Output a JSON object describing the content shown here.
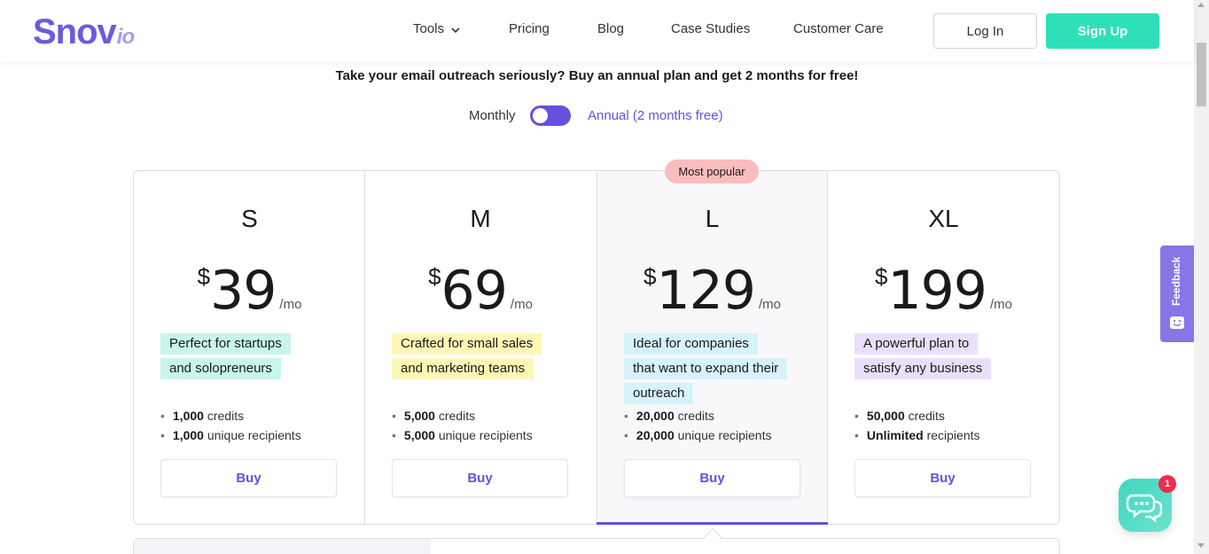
{
  "header": {
    "logo_main": "Snov",
    "logo_suffix": "io",
    "nav": [
      "Tools",
      "Pricing",
      "Blog",
      "Case Studies",
      "Customer Care"
    ],
    "login_label": "Log In",
    "signup_label": "Sign Up"
  },
  "promo_text": "Take your email outreach seriously? Buy an annual plan and get 2 months for free!",
  "billing_toggle": {
    "monthly_label": "Monthly",
    "annual_label": "Annual (2 months free)",
    "selected": "Annual (2 months free)"
  },
  "popular_badge": "Most popular",
  "plans": [
    {
      "name": "S",
      "currency": "$",
      "price": "39",
      "period": "/mo",
      "description": [
        "Perfect for startups",
        "and solopreneurs"
      ],
      "highlight_color": "#c8f5ec",
      "features": [
        {
          "value": "1,000",
          "label": "credits"
        },
        {
          "value": "1,000",
          "label": "unique recipients"
        }
      ],
      "buy_label": "Buy"
    },
    {
      "name": "M",
      "currency": "$",
      "price": "69",
      "period": "/mo",
      "description": [
        "Crafted for small sales",
        "and marketing teams"
      ],
      "highlight_color": "#fdf7b6",
      "features": [
        {
          "value": "5,000",
          "label": "credits"
        },
        {
          "value": "5,000",
          "label": "unique recipients"
        }
      ],
      "buy_label": "Buy"
    },
    {
      "name": "L",
      "currency": "$",
      "price": "129",
      "period": "/mo",
      "description": [
        "Ideal for companies",
        "that want to expand their",
        "outreach"
      ],
      "highlight_color": "#d6f2fb",
      "features": [
        {
          "value": "20,000",
          "label": "credits"
        },
        {
          "value": "20,000",
          "label": "unique recipients"
        }
      ],
      "buy_label": "Buy"
    },
    {
      "name": "XL",
      "currency": "$",
      "price": "199",
      "period": "/mo",
      "description": [
        "A powerful plan to",
        "satisfy any business"
      ],
      "highlight_color": "#eadffb",
      "features": [
        {
          "value": "50,000",
          "label": "credits"
        },
        {
          "value": "Unlimited",
          "label": "recipients"
        }
      ],
      "buy_label": "Buy"
    }
  ],
  "feedback_tab": "Feedback",
  "chat": {
    "unread_count": "1"
  },
  "colors": {
    "accent": "#6650dd",
    "signup": "#2ee0b8",
    "badge": "#fbbcbc"
  }
}
